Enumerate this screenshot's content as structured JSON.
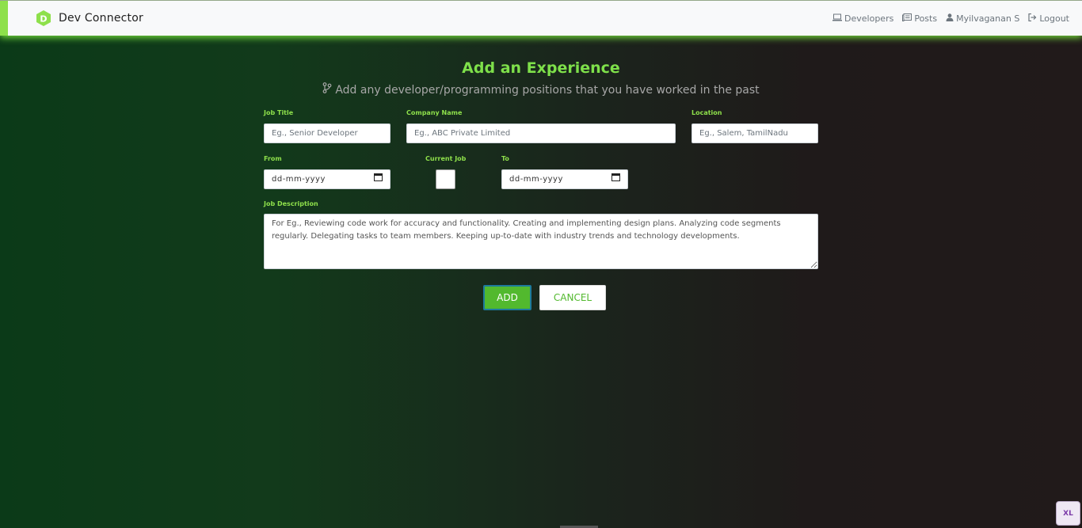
{
  "navbar": {
    "brand": "Dev Connector",
    "links": [
      {
        "label": "Developers",
        "icon": "laptop-icon"
      },
      {
        "label": "Posts",
        "icon": "posts-icon"
      },
      {
        "label": "Myilvaganan S",
        "icon": "user-icon"
      },
      {
        "label": "Logout",
        "icon": "logout-icon"
      }
    ]
  },
  "page": {
    "title": "Add an Experience",
    "lead": "Add any developer/programming positions that you have worked in the past"
  },
  "form": {
    "job_title": {
      "label": "Job Title",
      "placeholder": "Eg., Senior Developer"
    },
    "company": {
      "label": "Company Name",
      "placeholder": "Eg., ABC Private Limited"
    },
    "location": {
      "label": "Location",
      "placeholder": "Eg., Salem, TamilNadu"
    },
    "from": {
      "label": "From",
      "value": "dd-mm-yyyy"
    },
    "current_job": {
      "label": "Current Job",
      "checked": false
    },
    "to": {
      "label": "To",
      "value": "dd-mm-yyyy"
    },
    "description": {
      "label": "Job Description",
      "placeholder": "For Eg., Reviewing code work for accuracy and functionality. Creating and implementing design plans. Analyzing code segments regularly. Delegating tasks to team members. Keeping up-to-date with industry trends and technology developments."
    },
    "add_label": "ADD",
    "cancel_label": "CANCEL"
  },
  "badge": "XL",
  "colors": {
    "accent": "#8ee04b",
    "button": "#52b92e"
  }
}
